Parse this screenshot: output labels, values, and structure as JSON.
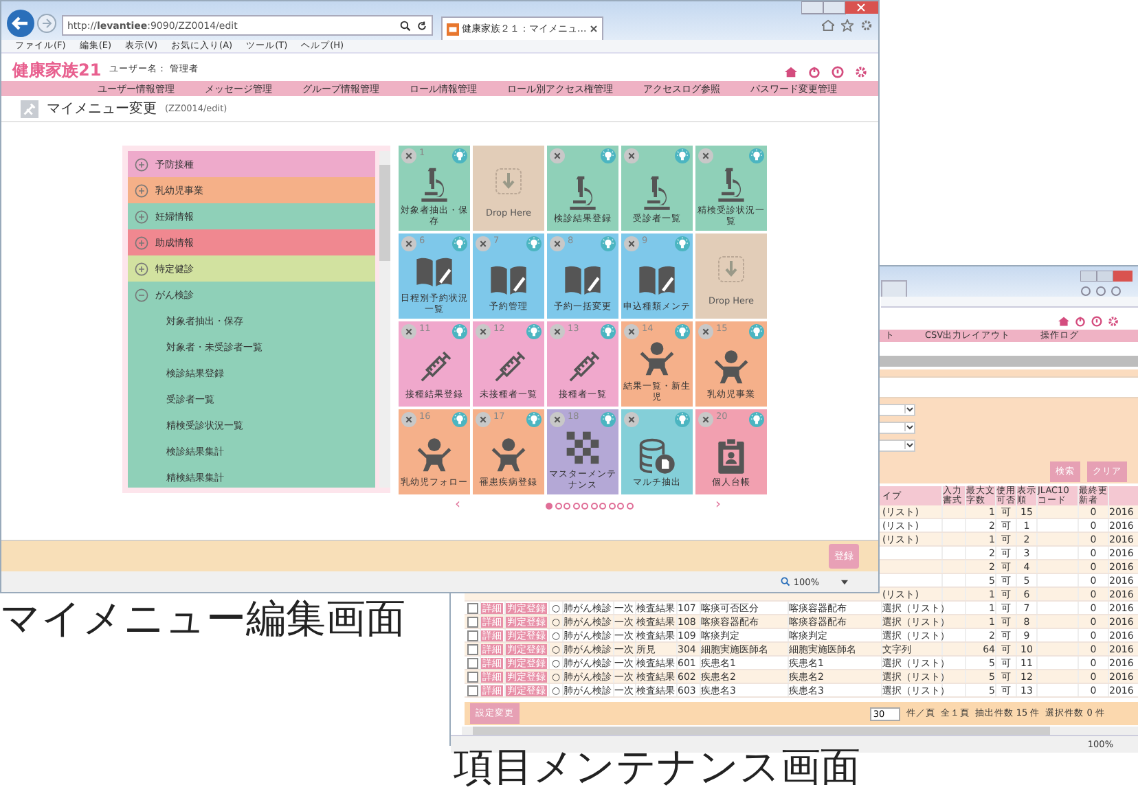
{
  "browser": {
    "url": "http://**levantiee**:9090/ZZ0014/edit",
    "tab_title": "健康家族２１：マイメニュ...",
    "menu": [
      "ファイル(F)",
      "編集(E)",
      "表示(V)",
      "お気に入り(A)",
      "ツール(T)",
      "ヘルプ(H)"
    ]
  },
  "app": {
    "logo": "健康家族21",
    "user_label": "ユーザー名：",
    "user": "管理者"
  },
  "nav": [
    "ユーザー情報管理",
    "メッセージ管理",
    "グループ情報管理",
    "ロール情報管理",
    "ロール別アクセス権管理",
    "アクセスログ参照",
    "パスワード変更管理"
  ],
  "page": {
    "title": "マイメニュー変更",
    "code": "(ZZ0014/edit)"
  },
  "menu_tree": [
    {
      "label": "予防接種",
      "color": "#eeaacb",
      "expanded": false
    },
    {
      "label": "乳幼児事業",
      "color": "#f5b088",
      "expanded": false
    },
    {
      "label": "妊婦情報",
      "color": "#8fd0b8",
      "expanded": false
    },
    {
      "label": "助成情報",
      "color": "#f08890",
      "expanded": false
    },
    {
      "label": "特定健診",
      "color": "#d2e2a0",
      "expanded": false
    },
    {
      "label": "がん検診",
      "color": "#8fd0b8",
      "expanded": true,
      "children": [
        {
          "label": "対象者抽出・保存"
        },
        {
          "label": "対象者・未受診者一覧"
        },
        {
          "label": "検診結果登録"
        },
        {
          "label": "受診者一覧"
        },
        {
          "label": "精検受診状況一覧"
        },
        {
          "label": "検診結果集計"
        },
        {
          "label": "精検結果集計"
        }
      ]
    }
  ],
  "tiles": [
    {
      "kind": "microscope",
      "number": "1",
      "label": "対象者抽出・保存",
      "color": "#8fd0b8"
    },
    {
      "kind": "drop",
      "label": "Drop Here"
    },
    {
      "kind": "microscope",
      "label": "検診結果登録",
      "color": "#8fd0b8"
    },
    {
      "kind": "microscope",
      "label": "受診者一覧",
      "color": "#8fd0b8"
    },
    {
      "kind": "microscope",
      "label": "精検受診状況一覧",
      "color": "#8fd0b8"
    },
    {
      "kind": "book",
      "number": "6",
      "label": "日程別予約状況一覧",
      "color": "#7ec8ea"
    },
    {
      "kind": "book",
      "number": "7",
      "label": "予約管理",
      "color": "#7ec8ea"
    },
    {
      "kind": "book",
      "number": "8",
      "label": "予約一括変更",
      "color": "#7ec8ea"
    },
    {
      "kind": "book",
      "number": "9",
      "label": "申込種類メンテ",
      "color": "#7ec8ea"
    },
    {
      "kind": "drop",
      "label": "Drop Here"
    },
    {
      "kind": "syringe",
      "number": "11",
      "label": "接種結果登録",
      "color": "#f0a8cc"
    },
    {
      "kind": "syringe",
      "number": "12",
      "label": "未接種者一覧",
      "color": "#f0a8cc"
    },
    {
      "kind": "syringe",
      "number": "13",
      "label": "接種者一覧",
      "color": "#f0a8cc"
    },
    {
      "kind": "baby",
      "number": "14",
      "label": "結果一覧・新生児",
      "color": "#f5b08a"
    },
    {
      "kind": "baby",
      "number": "15",
      "label": "乳幼児事業",
      "color": "#f5b08a"
    },
    {
      "kind": "baby",
      "number": "16",
      "label": "乳幼児フォロー",
      "color": "#f5b08a"
    },
    {
      "kind": "baby",
      "number": "17",
      "label": "罹患疾病登録",
      "color": "#f5b08a"
    },
    {
      "kind": "checker",
      "number": "18",
      "label": "マスターメンテナンス",
      "color": "#b4a8d6"
    },
    {
      "kind": "database",
      "label": "マルチ抽出",
      "color": "#84cfd8"
    },
    {
      "kind": "badge",
      "number": "20",
      "label": "個人台帳",
      "color": "#f2a0b0"
    }
  ],
  "pager": {
    "prev": "‹",
    "next": "›",
    "pages": [
      {
        "selected": true
      },
      {
        "selected": false
      },
      {
        "selected": false
      },
      {
        "selected": false
      },
      {
        "selected": false
      },
      {
        "selected": false
      },
      {
        "selected": false
      },
      {
        "selected": false
      },
      {
        "selected": false
      },
      {
        "selected": false
      }
    ]
  },
  "footer": {
    "register": "登録"
  },
  "status": {
    "zoom": "100%"
  },
  "back_window": {
    "nav": [
      "ト",
      "CSV出力レイアウト",
      "操作ログ"
    ],
    "buttons": [
      "検索",
      "クリア"
    ],
    "columns": [
      "イプ",
      "入力書式",
      "最大文字数",
      "使用可否",
      "表示順",
      "JLAC10コード",
      "最終更新者"
    ],
    "rows": [
      {
        "kind": "partial",
        "type": "(リスト)",
        "max": "1",
        "usable": "可",
        "order": "15",
        "updater": "0",
        "date": "2016"
      },
      {
        "kind": "partial",
        "type": "(リスト)",
        "max": "2",
        "usable": "可",
        "order": "1",
        "updater": "0",
        "date": "2016"
      },
      {
        "kind": "partial",
        "type": "(リスト)",
        "max": "1",
        "usable": "可",
        "order": "2",
        "updater": "0",
        "date": "2016"
      },
      {
        "kind": "partial",
        "max": "2",
        "usable": "可",
        "order": "3",
        "updater": "0",
        "date": "2016"
      },
      {
        "kind": "partial",
        "max": "2",
        "usable": "可",
        "order": "4",
        "updater": "0",
        "date": "2016"
      },
      {
        "kind": "partial",
        "max": "5",
        "usable": "可",
        "order": "5",
        "updater": "0",
        "date": "2016"
      },
      {
        "kind": "partial",
        "type": "(リスト)",
        "max": "1",
        "usable": "可",
        "order": "6",
        "updater": "0",
        "date": "2016"
      },
      {
        "kind": "full",
        "checked": false,
        "detail": "詳細",
        "judge": "判定登録",
        "mark": "○",
        "exam": "肺がん検診",
        "stage": "一次",
        "category": "検査結果",
        "code": "107",
        "item": "喀痰可否区分",
        "name": "喀痰容器配布",
        "type": "選択（リスト）",
        "max": "1",
        "usable": "可",
        "order": "7",
        "updater": "0",
        "date": "2016"
      },
      {
        "kind": "full",
        "checked": false,
        "detail": "詳細",
        "judge": "判定登録",
        "mark": "○",
        "exam": "肺がん検診",
        "stage": "一次",
        "category": "検査結果",
        "code": "108",
        "item": "喀痰容器配布",
        "name": "喀痰容器配布",
        "type": "選択（リスト）",
        "max": "1",
        "usable": "可",
        "order": "8",
        "updater": "0",
        "date": "2016"
      },
      {
        "kind": "full",
        "checked": false,
        "detail": "詳細",
        "judge": "判定登録",
        "mark": "○",
        "exam": "肺がん検診",
        "stage": "一次",
        "category": "検査結果",
        "code": "109",
        "item": "喀痰判定",
        "name": "喀痰判定",
        "type": "選択（リスト）",
        "max": "2",
        "usable": "可",
        "order": "9",
        "updater": "0",
        "date": "2016"
      },
      {
        "kind": "full",
        "checked": false,
        "detail": "詳細",
        "judge": "判定登録",
        "mark": "○",
        "exam": "肺がん検診",
        "stage": "一次",
        "category": "所見",
        "code": "304",
        "item": "細胞実施医師名",
        "name": "細胞実施医師名",
        "type": "文字列",
        "max": "64",
        "usable": "可",
        "order": "10",
        "updater": "0",
        "date": "2016"
      },
      {
        "kind": "full",
        "checked": false,
        "detail": "詳細",
        "judge": "判定登録",
        "mark": "○",
        "exam": "肺がん検診",
        "stage": "一次",
        "category": "検査結果",
        "code": "601",
        "item": "疾患名1",
        "name": "疾患名1",
        "type": "選択（リスト）",
        "max": "5",
        "usable": "可",
        "order": "11",
        "updater": "0",
        "date": "2016"
      },
      {
        "kind": "full",
        "checked": false,
        "detail": "詳細",
        "judge": "判定登録",
        "mark": "○",
        "exam": "肺がん検診",
        "stage": "一次",
        "category": "検査結果",
        "code": "602",
        "item": "疾患名2",
        "name": "疾患名2",
        "type": "選択（リスト）",
        "max": "5",
        "usable": "可",
        "order": "12",
        "updater": "0",
        "date": "2016"
      },
      {
        "kind": "full",
        "checked": false,
        "detail": "詳細",
        "judge": "判定登録",
        "mark": "○",
        "exam": "肺がん検診",
        "stage": "一次",
        "category": "検査結果",
        "code": "603",
        "item": "疾患名3",
        "name": "疾患名3",
        "type": "選択（リスト）",
        "max": "5",
        "usable": "可",
        "order": "13",
        "updater": "0",
        "date": "2016"
      }
    ],
    "footer": {
      "button": "設定変更",
      "page_size": "30",
      "per_page": "件／頁",
      "pages": "全１頁",
      "extracted": "抽出件数 15 件",
      "selected": "選択件数 0 件"
    },
    "zoom": "100%"
  },
  "captions": [
    "マイメニュー編集画面",
    "項目メンテナンス画面"
  ]
}
